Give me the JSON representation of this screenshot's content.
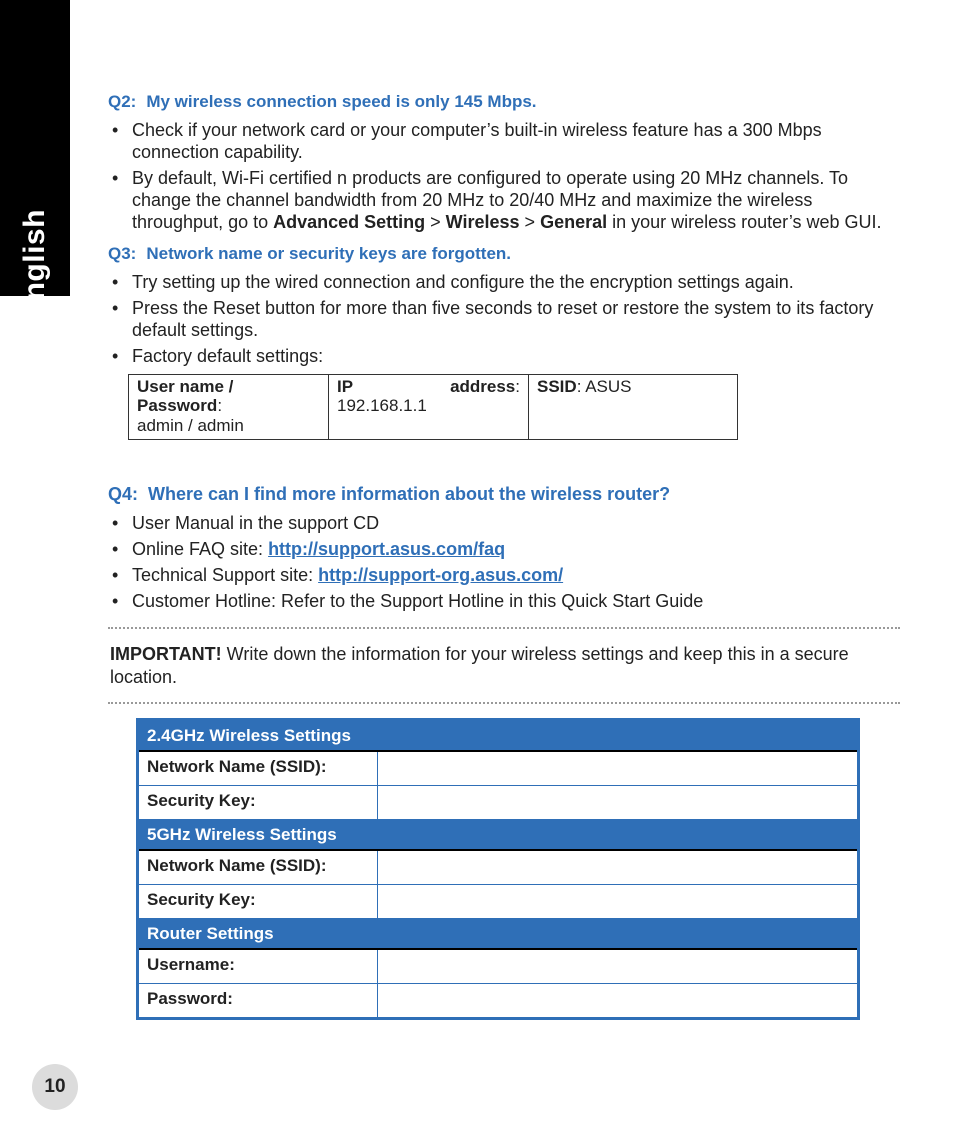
{
  "language_tab": "English",
  "page_number": "10",
  "q2": {
    "num": "Q2:",
    "text": "My wireless connection speed is only 145 Mbps.",
    "bullets": [
      {
        "text": "Check if your network card or your computer’s built-in wireless feature has a 300 Mbps connection capability."
      },
      {
        "pre": "By default, Wi-Fi certified n products are configured to operate using 20 MHz chan­nels. To change the channel bandwidth from 20 MHz to 20/40 MHz and maximize the wireless throughput, go to ",
        "b1": "Advanced Setting",
        "s1": " > ",
        "b2": "Wireless",
        "s2": " > ",
        "b3": "General",
        "post": " in your wireless router’s web GUI."
      }
    ]
  },
  "q3": {
    "num": "Q3:",
    "text": "Network name or security keys are forgotten.",
    "bullets": [
      "Try setting up the wired connection and configure the the encryption settings again.",
      "Press the Reset button for more than five seconds to reset or restore the system to its factory default settings.",
      "Factory default settings:"
    ],
    "defaults": {
      "c1_label": "User name / Password",
      "c1_value": "admin / admin",
      "c2_label_a": "IP",
      "c2_label_b": "address",
      "c2_value": "192.168.1.1",
      "c3_label": "SSID",
      "c3_value": "ASUS"
    }
  },
  "q4": {
    "num": "Q4:",
    "text": "Where can I find more information about the wireless router?",
    "bullets": {
      "b1": "User Manual in the support CD",
      "b2_pre": "Online FAQ site: ",
      "b2_link": "http://support.asus.com/faq",
      "b3_pre": "Technical Support site: ",
      "b3_link": "http://support-org.asus.com/",
      "b4": "Customer Hotline: Refer to the Support Hotline in this Quick Start Guide"
    }
  },
  "important": {
    "lead": "IMPORTANT!",
    "text": "  Write down the information for your wireless settings and keep this in a secure location."
  },
  "settings_table": {
    "s1": "2.4GHz Wireless Settings",
    "s2": "5GHz Wireless Settings",
    "s3": "Router Settings",
    "ssid": "Network Name (SSID):",
    "key": "Security Key:",
    "user": "Username:",
    "pass": "Password:"
  }
}
